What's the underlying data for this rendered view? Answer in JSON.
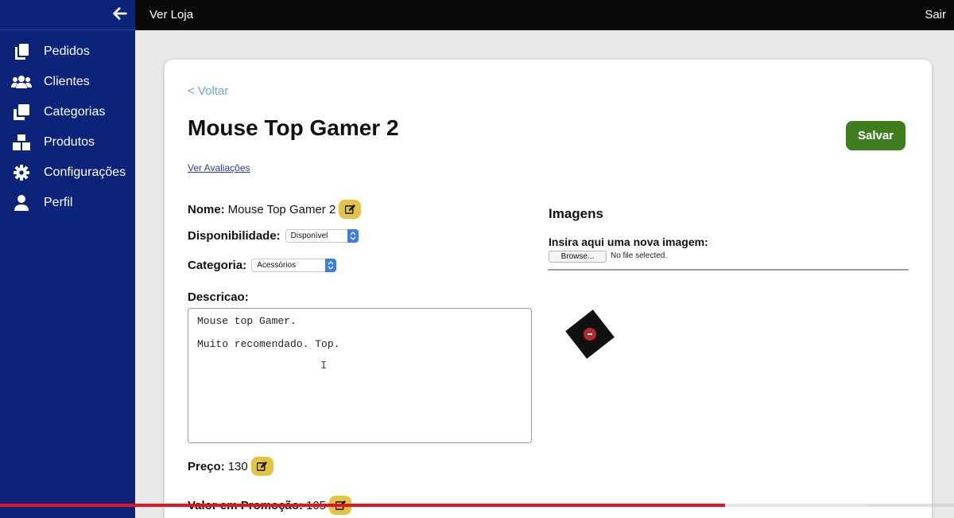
{
  "sidebar": {
    "items": [
      {
        "label": "Pedidos",
        "icon": "copy-icon"
      },
      {
        "label": "Clientes",
        "icon": "users-icon"
      },
      {
        "label": "Categorias",
        "icon": "clone-icon"
      },
      {
        "label": "Produtos",
        "icon": "boxes-icon"
      },
      {
        "label": "Configurações",
        "icon": "gear-icon"
      },
      {
        "label": "Perfil",
        "icon": "user-icon"
      }
    ]
  },
  "topbar": {
    "store_link": "Ver Loja",
    "logout": "Sair"
  },
  "product": {
    "back": "< Voltar",
    "title": "Mouse Top Gamer 2",
    "save": "Salvar",
    "reviews_link": "Ver Avaliações",
    "name_label": "Nome:",
    "name_value": "Mouse Top Gamer 2",
    "availability_label": "Disponibilidade:",
    "availability_value": "Disponível",
    "category_label": "Categoria:",
    "category_value": "Acessórios",
    "description_label": "Descricao:",
    "description_lines": [
      "Mouse top Gamer.",
      "Muito recomendado. Top."
    ],
    "price_label": "Preço:",
    "price_value": "130",
    "promo_label": "Valor em Promoção:",
    "promo_value": "105"
  },
  "images": {
    "title": "Imagens",
    "upload_label": "Insira aqui uma nova imagem:",
    "browse": "Browse...",
    "no_file": "No file selected."
  },
  "video": {
    "progress": 0.76,
    "buffered": 0.91
  },
  "colors": {
    "sidebar": "#0b2378",
    "topbar": "#0a0a0a",
    "save": "#3f7d20",
    "edit": "#e4c341",
    "link": "#6aa3e6",
    "progress": "#e8121f"
  }
}
